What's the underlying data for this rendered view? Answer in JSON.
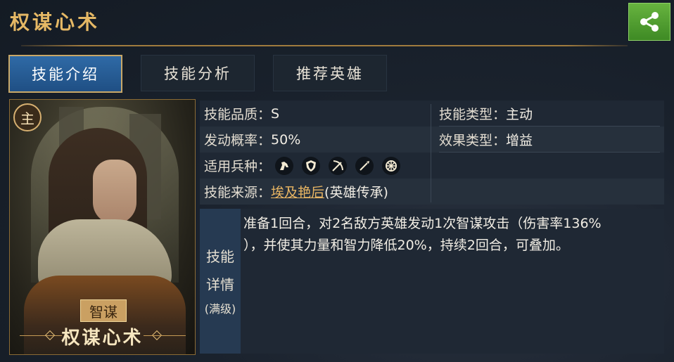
{
  "header": {
    "title": "权谋心术"
  },
  "share": {
    "icon": "share-icon"
  },
  "tabs": [
    {
      "label": "技能介绍",
      "active": true
    },
    {
      "label": "技能分析",
      "active": false
    },
    {
      "label": "推荐英雄",
      "active": false
    }
  ],
  "card": {
    "main_badge": "主",
    "type_tag": "智谋",
    "name": "权谋心术"
  },
  "info": {
    "quality_label": "技能品质：",
    "quality_value": "S",
    "skill_type_label": "技能类型：",
    "skill_type_value": "主动",
    "chance_label": "发动概率：",
    "chance_value": "50%",
    "effect_type_label": "效果类型：",
    "effect_type_value": "增益",
    "units_label": "适用兵种：",
    "units": [
      "cavalry-icon",
      "shield-icon",
      "archer-icon",
      "spear-icon",
      "siege-icon"
    ],
    "source_label": "技能来源：",
    "source_hero": "埃及艳后",
    "source_suffix": "(英雄传承)"
  },
  "detail": {
    "label_line1": "技能",
    "label_line2": "详情",
    "label_line3": "(满级)",
    "text_line1": "准备1回合，对2名敌方英雄发动1次智谋攻击（伤害率136%",
    "text_line2": "），并使其力量和智力降低20%，持续2回合，可叠加。"
  },
  "colors": {
    "accent_gold": "#e5b865",
    "tab_active": "#2f6aa6",
    "share_green": "#4c9e2f"
  }
}
